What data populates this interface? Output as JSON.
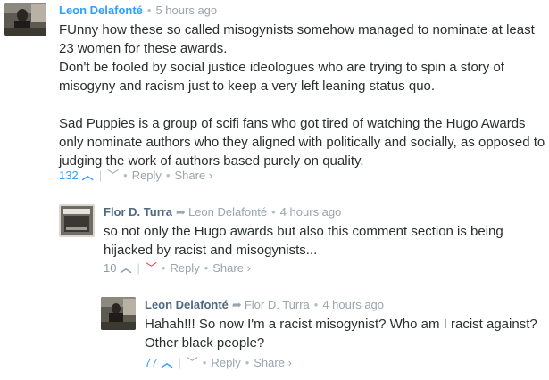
{
  "comments": [
    {
      "author": "Leon Delafonté",
      "time": "5 hours ago",
      "paragraphs": [
        "FUnny how these so called misogynists somehow managed to nominate at least 23 women for these awards.\nDon't be fooled by social justice ideologues who are trying to spin a story of misogyny and racism just to keep a very left leaning status quo.",
        "Sad Puppies is a group of scifi fans who got tired of watching the Hugo Awards only nominate authors who they aligned with politically and socially, as opposed to judging the work of authors based purely on quality."
      ],
      "votes": "132",
      "up_icon": "chevron-up-icon",
      "down_icon": "chevron-down-icon",
      "reply_label": "Reply",
      "share_label": "Share ›"
    },
    {
      "author": "Flor D. Turra",
      "in_reply_to": "Leon Delafonté",
      "time": "4 hours ago",
      "paragraphs": [
        "so not only the Hugo awards but also this comment section is being hijacked by racist and misogynists..."
      ],
      "votes": "10",
      "up_icon": "chevron-up-icon",
      "down_icon": "chevron-down-icon",
      "reply_label": "Reply",
      "share_label": "Share ›"
    },
    {
      "author": "Leon Delafonté",
      "in_reply_to": "Flor D. Turra",
      "time": "4 hours ago",
      "paragraphs": [
        "Hahah!!! So now I'm a racist misogynist? Who am I racist against? Other black people?"
      ],
      "votes": "77",
      "up_icon": "chevron-up-icon",
      "down_icon": "chevron-down-icon",
      "reply_label": "Reply",
      "share_label": "Share ›"
    }
  ],
  "separator": "•",
  "reply_arrow": "➦",
  "colors": {
    "accent": "#2e9fff",
    "downvote_active": "#e0433f",
    "muted": "#9aa5ad",
    "text": "#2a2e2e"
  }
}
